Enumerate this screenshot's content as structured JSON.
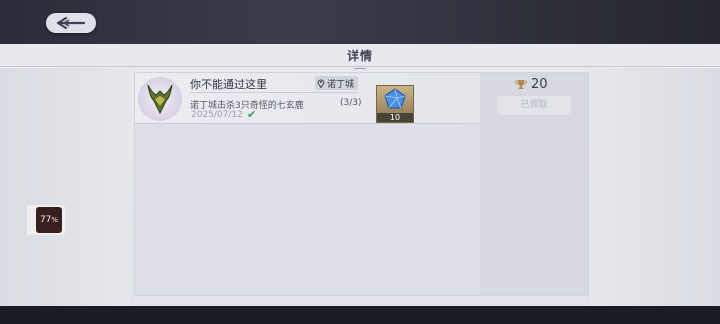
{
  "header": {
    "back_icon": "back-arrow-icon"
  },
  "panel": {
    "title": "详情"
  },
  "task": {
    "name": "你不能通过这里",
    "location": "诺丁城",
    "location_icon": "map-pin-icon",
    "description": "诺丁城击杀3只奇怪的七玄鹿",
    "progress": "(3/3)",
    "date": "2025/07/12",
    "complete_icon": "checkmark-icon",
    "badge_icon": "horned-emblem-icon",
    "reward_item": {
      "icon": "blue-crystal-icon",
      "count": "10"
    }
  },
  "reward": {
    "points": "20",
    "points_icon": "trophy-icon",
    "claim_label": "已领取"
  },
  "overlay": {
    "progress_value": "77",
    "progress_unit": "%"
  },
  "colors": {
    "panel_bg": "#e6e7ec",
    "accent_check": "#3c9a55",
    "item_frame": "#c9b48a"
  }
}
